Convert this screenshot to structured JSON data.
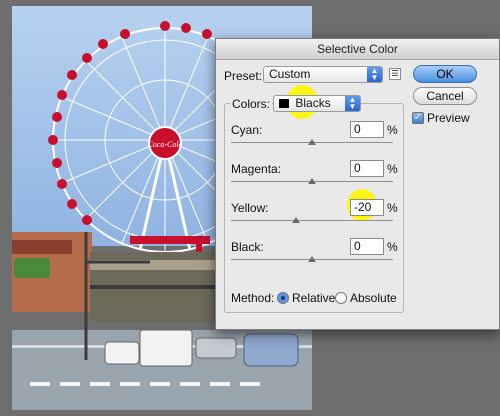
{
  "dialog": {
    "title": "Selective Color",
    "preset_label": "Preset:",
    "preset_value": "Custom",
    "colors_label": "Colors:",
    "colors_value": "Blacks",
    "ok_label": "OK",
    "cancel_label": "Cancel",
    "preview_label": "Preview",
    "preview_checked": true,
    "sliders": [
      {
        "label": "Cyan:",
        "value": "0",
        "unit": "%"
      },
      {
        "label": "Magenta:",
        "value": "0",
        "unit": "%"
      },
      {
        "label": "Yellow:",
        "value": "-20",
        "unit": "%"
      },
      {
        "label": "Black:",
        "value": "0",
        "unit": "%"
      }
    ],
    "method_label": "Method:",
    "method_options": [
      "Relative",
      "Absolute"
    ],
    "method_selected": "Relative"
  },
  "photo": {
    "sign_text": "Coca-Cola"
  },
  "colors": {
    "highlight": "#fff500",
    "accent": "#3f7fd8",
    "sky": "#9dbfe8"
  }
}
